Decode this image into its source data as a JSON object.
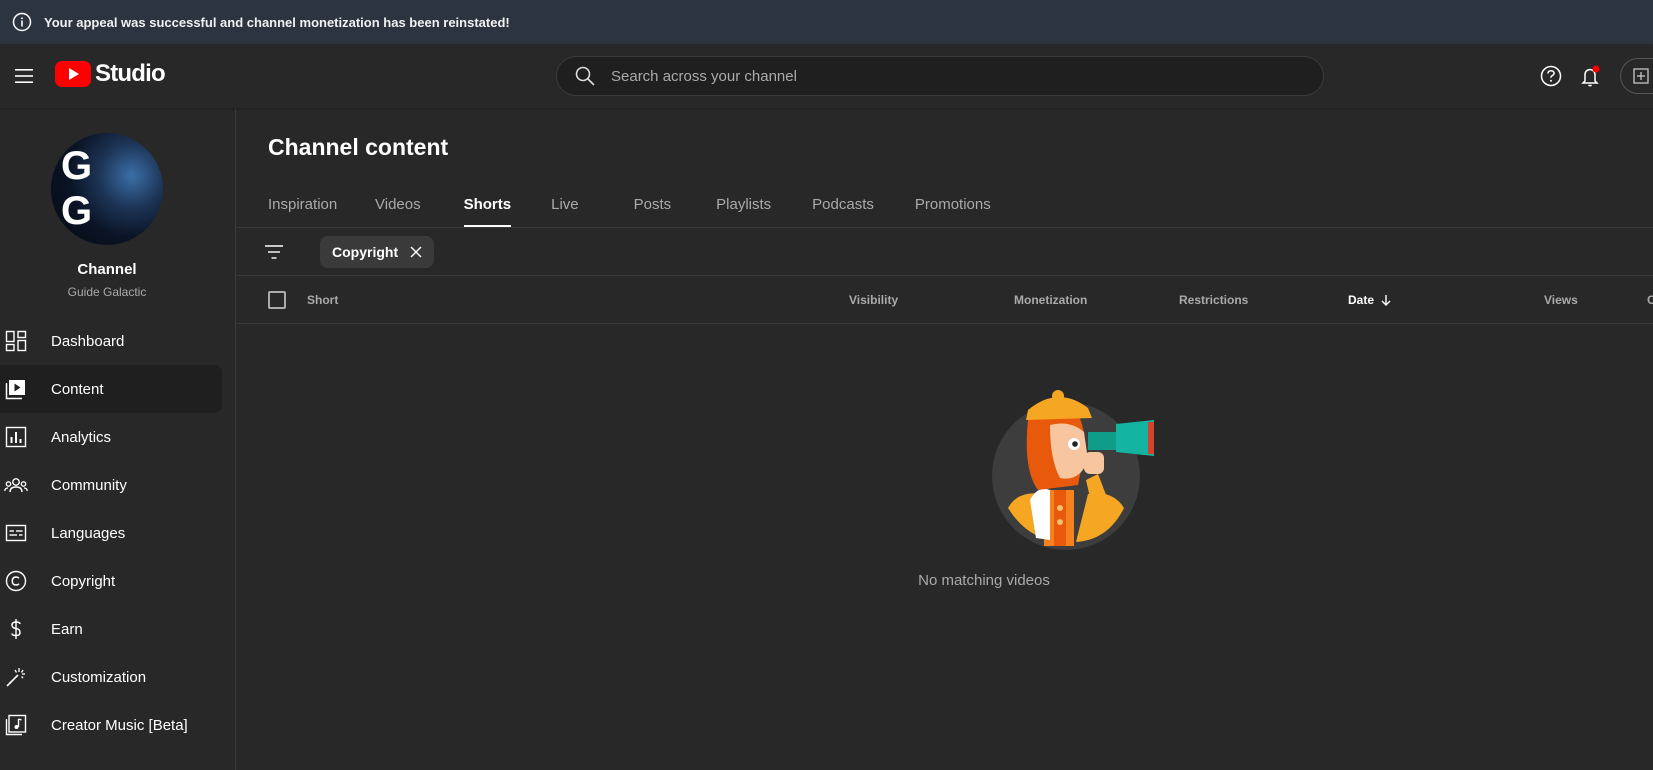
{
  "banner": {
    "text": "Your appeal was successful and channel monetization has been reinstated!"
  },
  "header": {
    "logo_text": "Studio",
    "search_placeholder": "Search across your channel"
  },
  "sidebar": {
    "avatar_text": "G G",
    "channel_label": "Channel",
    "channel_name": "Guide Galactic",
    "items": [
      {
        "label": "Dashboard",
        "icon": "dashboard-icon"
      },
      {
        "label": "Content",
        "icon": "content-icon",
        "active": true
      },
      {
        "label": "Analytics",
        "icon": "analytics-icon"
      },
      {
        "label": "Community",
        "icon": "community-icon"
      },
      {
        "label": "Languages",
        "icon": "languages-icon"
      },
      {
        "label": "Copyright",
        "icon": "copyright-icon"
      },
      {
        "label": "Earn",
        "icon": "earn-icon"
      },
      {
        "label": "Customization",
        "icon": "customization-icon"
      },
      {
        "label": "Creator Music [Beta]",
        "icon": "creator-music-icon"
      }
    ]
  },
  "main": {
    "title": "Channel content",
    "tabs": [
      {
        "label": "Inspiration"
      },
      {
        "label": "Videos"
      },
      {
        "label": "Shorts",
        "active": true
      },
      {
        "label": "Live"
      },
      {
        "label": "Posts"
      },
      {
        "label": "Playlists"
      },
      {
        "label": "Podcasts"
      },
      {
        "label": "Promotions"
      }
    ],
    "filter_chip": "Copyright",
    "columns": {
      "short": "Short",
      "visibility": "Visibility",
      "monetization": "Monetization",
      "restrictions": "Restrictions",
      "date": "Date",
      "views": "Views",
      "comments": "C"
    },
    "empty_text": "No matching videos"
  },
  "colors": {
    "background": "#282828",
    "banner": "#2c3440",
    "youtube_red": "#ff0000",
    "accent_teal": "#0f9d8a",
    "accent_orange": "#f5821f"
  }
}
